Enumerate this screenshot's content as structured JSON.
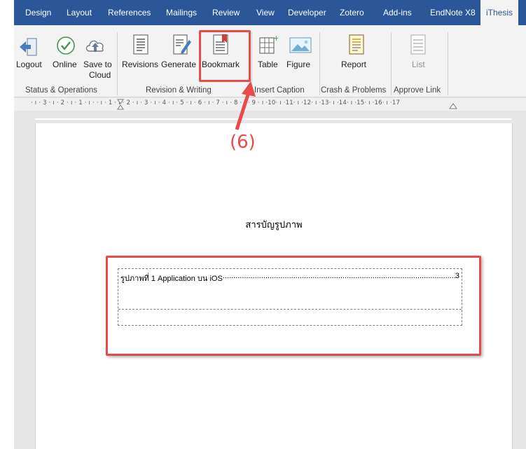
{
  "tabs": [
    "Design",
    "Layout",
    "References",
    "Mailings",
    "Review",
    "View",
    "Developer",
    "Zotero",
    "Add-ins",
    "EndNote X8",
    "iThesis"
  ],
  "ribbon": {
    "buttons": {
      "logout": "Logout",
      "online": "Online",
      "save_line1": "Save to",
      "save_line2": "Cloud",
      "revisions": "Revisions",
      "generate": "Generate",
      "bookmark": "Bookmark",
      "table": "Table",
      "figure": "Figure",
      "report": "Report",
      "list": "List"
    },
    "groups": {
      "status": "Status & Operations",
      "revision": "Revision & Writing",
      "caption": "Insert Caption",
      "crash": "Crash & Problems",
      "approve": "Approve Link"
    }
  },
  "ruler": "· ı · 3 · ı · 2 · ı · 1 · ı ·  · ı · 1 · ı · 2 · ı · 3 · ı · 4 · ı · 5 · ı · 6 · ı · 7 · ı · 8 · ı · 9 · ı ·10· ı ·11· ı ·12· ı ·13· ı ·14· ı ·15· ı ·16· ı ·17",
  "annotation": {
    "step_label": "(6)"
  },
  "document": {
    "heading": "สารบัญรูปภาพ",
    "toc_entry_text": "รูปภาพที่ 1 Application บน iOS",
    "toc_entry_dots": "...................................................................................................................................................................................",
    "toc_entry_page": "3"
  },
  "colors": {
    "tab_bar": "#2b579a",
    "ribbon_bg": "#f3f3f3",
    "highlight": "#e84a4a"
  }
}
